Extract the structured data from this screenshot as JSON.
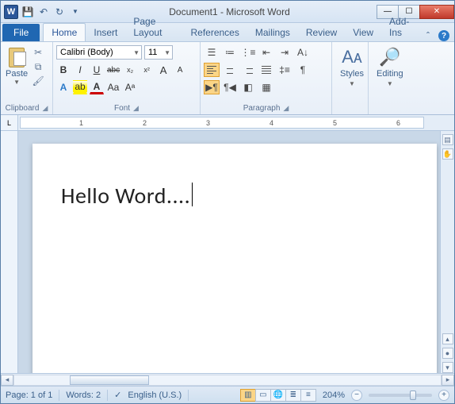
{
  "title": "Document1 - Microsoft Word",
  "app_letter": "W",
  "tabs": {
    "file": "File",
    "items": [
      "Home",
      "Insert",
      "Page Layout",
      "References",
      "Mailings",
      "Review",
      "View",
      "Add-Ins"
    ],
    "active": "Home"
  },
  "clipboard": {
    "paste": "Paste",
    "group_label": "Clipboard"
  },
  "font": {
    "family": "Calibri (Body)",
    "size": "11",
    "group_label": "Font",
    "bold": "B",
    "italic": "I",
    "underline": "U",
    "strike": "abc",
    "sub": "x₂",
    "sup": "x²",
    "grow": "A",
    "shrink": "A",
    "case": "Aa",
    "clear": "Aᵃ"
  },
  "paragraph": {
    "group_label": "Paragraph"
  },
  "styles": {
    "label": "Styles"
  },
  "editing": {
    "label": "Editing"
  },
  "document": {
    "text": "Hello Word...."
  },
  "status": {
    "page": "Page: 1 of 1",
    "words": "Words: 2",
    "language": "English (U.S.)",
    "zoom": "204%"
  },
  "ruler_numbers": [
    "1",
    "2",
    "3",
    "4",
    "5",
    "6"
  ]
}
